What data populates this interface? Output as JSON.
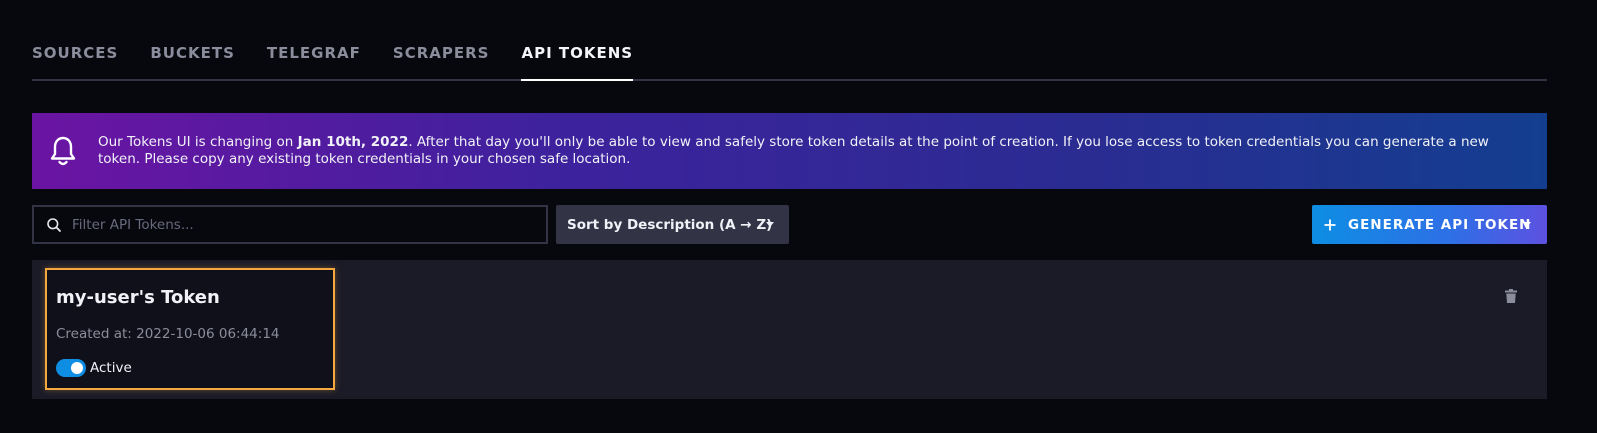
{
  "tabs": [
    {
      "label": "SOURCES",
      "active": false
    },
    {
      "label": "BUCKETS",
      "active": false
    },
    {
      "label": "TELEGRAF",
      "active": false
    },
    {
      "label": "SCRAPERS",
      "active": false
    },
    {
      "label": "API TOKENS",
      "active": true
    }
  ],
  "banner": {
    "icon": "bell-icon",
    "text_before": "Our Tokens UI is changing on ",
    "text_bold": "Jan 10th, 2022",
    "text_after": ". After that day you'll only be able to view and safely store token details at the point of creation. If you lose access to token credentials you can generate a new token. Please copy any existing token credentials in your chosen safe location."
  },
  "search": {
    "icon": "search-icon",
    "placeholder": "Filter API Tokens...",
    "value": ""
  },
  "sort": {
    "label": "Sort by Description (A → Z)"
  },
  "generate": {
    "label": "GENERATE API TOKEN"
  },
  "tokens": [
    {
      "name": "my-user's Token",
      "created": "Created at: 2022-10-06 06:44:14",
      "status_label": "Active",
      "active": true
    }
  ],
  "colors": {
    "background": "#07070e",
    "accent_blue": "#0d8ee3",
    "highlight_orange": "#f3a73c",
    "card_row": "#1b1b27",
    "banner_start": "#6b14a3",
    "banner_end": "#133e8f"
  }
}
